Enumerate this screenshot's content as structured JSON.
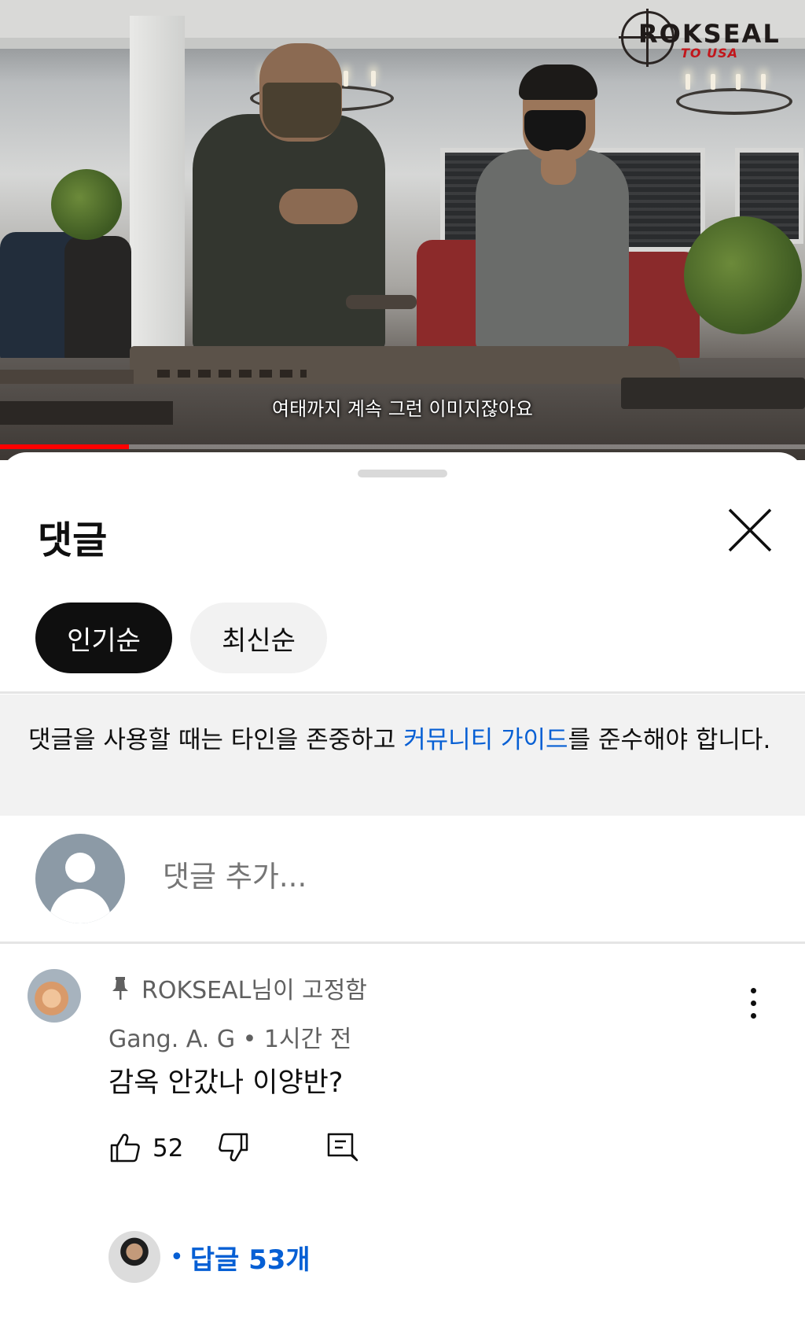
{
  "video": {
    "subtitle": "여태까지 계속 그런 이미지잖아요",
    "watermark": {
      "main": "ROKSEAL",
      "sub": "TO USA"
    },
    "progress": 0.16
  },
  "comments_panel": {
    "title": "댓글",
    "close_icon": "close-icon",
    "sort_chips": [
      {
        "label": "인기순",
        "active": true
      },
      {
        "label": "최신순",
        "active": false
      }
    ],
    "notice": {
      "before": "댓글을 사용할 때는 타인을 존중하고 ",
      "link": "커뮤니티 가이드",
      "after": "를 준수해야 합니다."
    },
    "add_comment": {
      "placeholder": "댓글 추가..."
    }
  },
  "comment": {
    "pinned_label": "ROKSEAL님이 고정함",
    "author": "Gang. A. G",
    "separator": "•",
    "time": "1시간 전",
    "text": "감옥 안갔나 이양반?",
    "like_count": "52",
    "replies": {
      "dot": "•",
      "label": "답글 53개"
    }
  },
  "colors": {
    "link": "#065fd4",
    "chip_active_bg": "#0f0f0f",
    "chip_inactive_bg": "#f2f2f2",
    "progress": "#ff0000",
    "secondary_text": "#606060"
  }
}
